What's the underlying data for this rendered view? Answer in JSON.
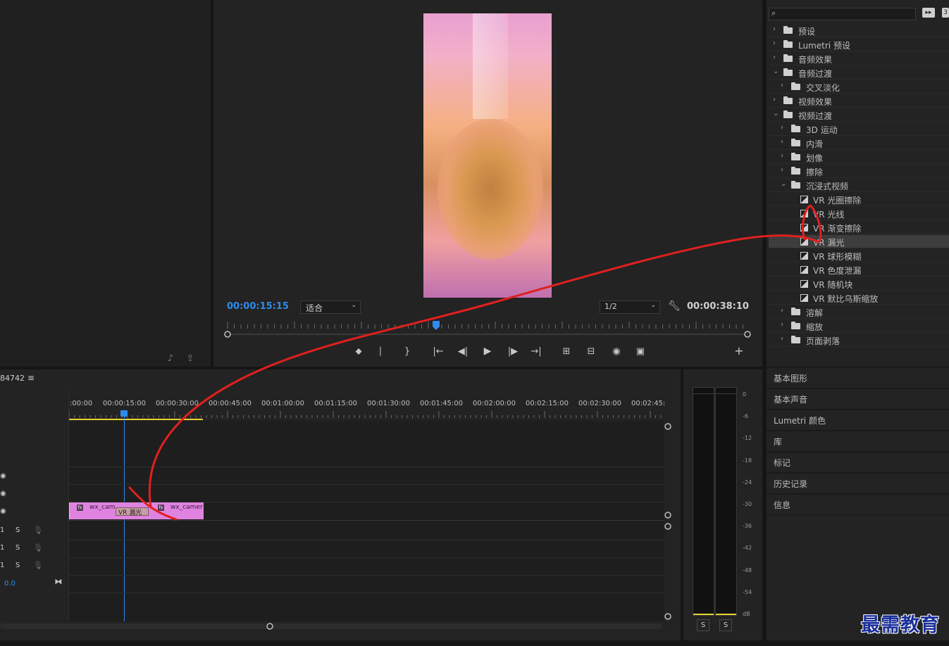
{
  "source_monitor": {
    "icons": [
      "audio-only-icon",
      "export-frame-icon"
    ]
  },
  "program_monitor": {
    "timecode_current": "00:00:15:15",
    "zoom_select": "适合",
    "resolution_select": "1/2",
    "timecode_duration": "00:00:38:10",
    "accent_color": "#2d8ceb"
  },
  "effects_panel": {
    "search_placeholder": "",
    "tree": [
      {
        "label": "预设",
        "level": 0,
        "kind": "preset-folder",
        "open": false
      },
      {
        "label": "Lumetri 预设",
        "level": 0,
        "kind": "preset-folder",
        "open": false
      },
      {
        "label": "音频效果",
        "level": 0,
        "kind": "folder",
        "open": false
      },
      {
        "label": "音频过渡",
        "level": 0,
        "kind": "folder",
        "open": true
      },
      {
        "label": "交叉淡化",
        "level": 1,
        "kind": "folder",
        "open": false
      },
      {
        "label": "视频效果",
        "level": 0,
        "kind": "folder",
        "open": false
      },
      {
        "label": "视频过渡",
        "level": 0,
        "kind": "folder",
        "open": true
      },
      {
        "label": "3D 运动",
        "level": 1,
        "kind": "folder",
        "open": false
      },
      {
        "label": "内滑",
        "level": 1,
        "kind": "folder",
        "open": false
      },
      {
        "label": "划像",
        "level": 1,
        "kind": "folder",
        "open": false
      },
      {
        "label": "擦除",
        "level": 1,
        "kind": "folder",
        "open": false
      },
      {
        "label": "沉浸式视频",
        "level": 1,
        "kind": "folder",
        "open": true
      },
      {
        "label": "VR 光圈擦除",
        "level": 2,
        "kind": "effect"
      },
      {
        "label": "VR 光线",
        "level": 2,
        "kind": "effect"
      },
      {
        "label": "VR 渐变擦除",
        "level": 2,
        "kind": "effect"
      },
      {
        "label": "VR 漏光",
        "level": 2,
        "kind": "effect",
        "selected": true
      },
      {
        "label": "VR 球形模糊",
        "level": 2,
        "kind": "effect"
      },
      {
        "label": "VR 色度泄漏",
        "level": 2,
        "kind": "effect"
      },
      {
        "label": "VR 随机块",
        "level": 2,
        "kind": "effect"
      },
      {
        "label": "VR 默比乌斯缩放",
        "level": 2,
        "kind": "effect"
      },
      {
        "label": "溶解",
        "level": 1,
        "kind": "folder",
        "open": false
      },
      {
        "label": "缩放",
        "level": 1,
        "kind": "folder",
        "open": false
      },
      {
        "label": "页面剥落",
        "level": 1,
        "kind": "folder",
        "open": false
      }
    ]
  },
  "side_panels": [
    "基本图形",
    "基本声音",
    "Lumetri 颜色",
    "库",
    "标记",
    "历史记录",
    "信息"
  ],
  "timeline": {
    "sequence_name": "84742",
    "menu_icon": "≡",
    "ruler_labels": [
      ":00:00",
      "00:00:15:00",
      "00:00:30:00",
      "00:00:45:00",
      "00:01:00:00",
      "00:01:15:00",
      "00:01:30:00",
      "00:01:45:00",
      "00:02:00:00",
      "00:02:15:00",
      "00:02:30:00",
      "00:02:45:"
    ],
    "clip_a_label": "wx_cam",
    "clip_b_label": "wx_camer",
    "transition_label": "VR 漏光",
    "clip_color": "#e083e0",
    "audio_solo_label": "S",
    "audio_track_prefix": "1",
    "master_value": "0.0",
    "playhead_color": "#2d8ceb"
  },
  "audio_meter": {
    "scale": [
      "0",
      "-6",
      "-12",
      "-18",
      "-24",
      "-30",
      "-36",
      "-42",
      "-48",
      "-54",
      "dB"
    ],
    "solo_buttons": [
      "S",
      "S"
    ]
  },
  "watermark": "最需教育",
  "annotation_color": "#e0201e"
}
